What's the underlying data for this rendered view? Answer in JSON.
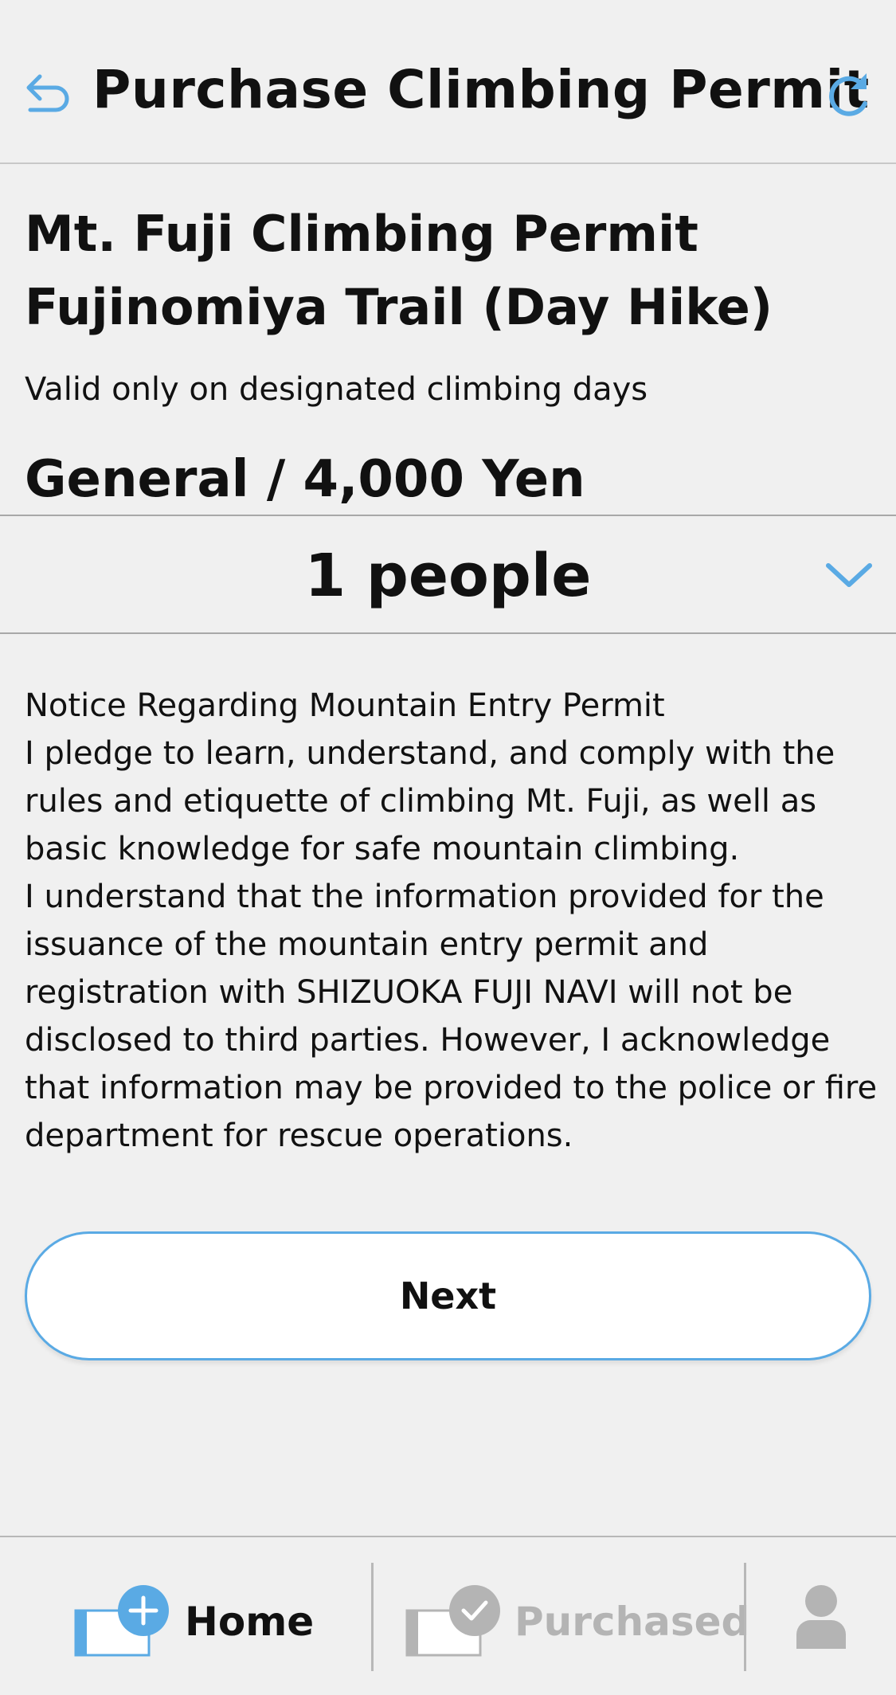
{
  "header": {
    "title": "Purchase Climbing Permit",
    "back_icon": "back-arrow-icon",
    "reload_icon": "reload-icon"
  },
  "permit": {
    "title_line1": "Mt. Fuji Climbing Permit",
    "title_line2": "Fujinomiya Trail (Day Hike)",
    "note": "Valid only on designated climbing days",
    "price": "General / 4,000 Yen"
  },
  "quantity": {
    "selected": "1 people",
    "icon": "chevron-down-icon"
  },
  "notice": {
    "heading": "Notice Regarding Mountain Entry Permit",
    "paragraph1": "I pledge to learn, understand, and comply with the rules and etiquette of climbing Mt. Fuji, as well as basic knowledge for safe mountain climbing.",
    "paragraph2": "I understand that the information provided for the issuance of the mountain entry permit and registration with SHIZUOKA FUJI NAVI will not be disclosed to third parties. However, I acknowledge that information may be provided to the police or fire department for rescue operations."
  },
  "actions": {
    "next_label": "Next"
  },
  "tabbar": {
    "home_label": "Home",
    "purchased_label": "Purchased",
    "profile_icon": "person-icon"
  },
  "colors": {
    "accent": "#5aaae4",
    "background": "#f0f0f0",
    "inactive": "#b4b4b4"
  }
}
